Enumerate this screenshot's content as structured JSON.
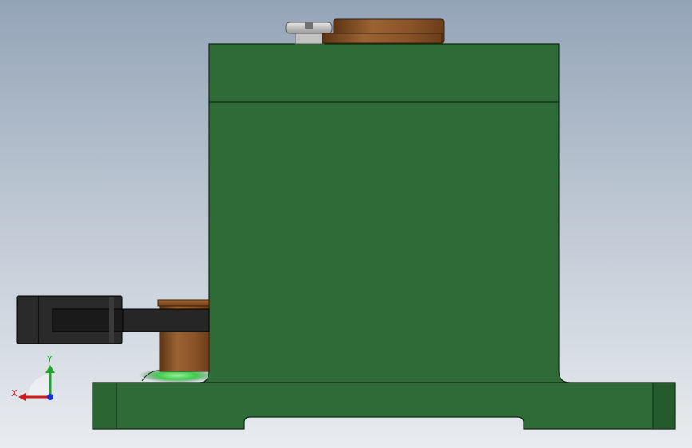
{
  "viewport": {
    "background_top": "#94a4b7",
    "background_bottom": "#e9ecf0"
  },
  "model": {
    "body_color": "#2e6b36",
    "body_edge_color": "#0f2a14",
    "bronze_color": "#8a5328",
    "screw_color": "#b8b8b8",
    "arm_color": "#262626"
  },
  "triad": {
    "x_label": "X",
    "y_label": "Y",
    "x_color": "#d11a1a",
    "y_color": "#1ea52a",
    "z_color": "#1a2fd1"
  }
}
